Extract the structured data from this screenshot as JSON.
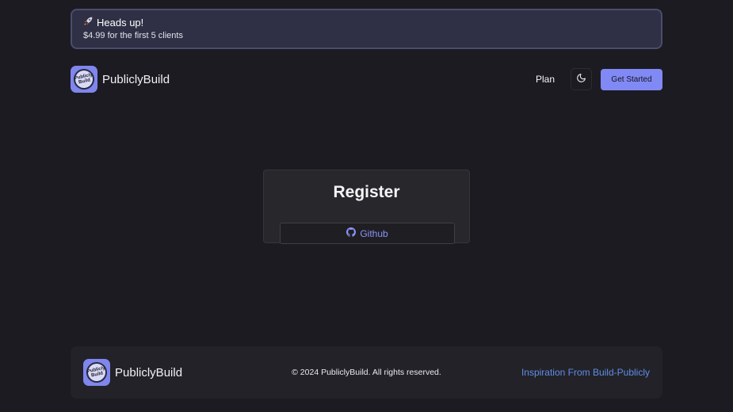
{
  "banner": {
    "icon": "rocket-icon",
    "title": "Heads up!",
    "subtitle": "$4.99 for the first 5 clients"
  },
  "header": {
    "brand": "PubliclyBuild",
    "logo_text_top": "Publicly",
    "logo_text_bottom": "Build",
    "nav_plan": "Plan",
    "theme_icon": "moon-icon",
    "cta_label": "Get Started"
  },
  "register": {
    "title": "Register",
    "github_label": "Github",
    "github_icon": "github-icon"
  },
  "footer": {
    "brand": "PubliclyBuild",
    "copyright": "© 2024 PubliclyBuild. All rights reserved.",
    "link": "Inspiration From Build-Publicly"
  },
  "colors": {
    "background": "#1c1b21",
    "accent": "#8189f4",
    "link": "#5e8ee6",
    "banner_bg": "#2f3045"
  }
}
